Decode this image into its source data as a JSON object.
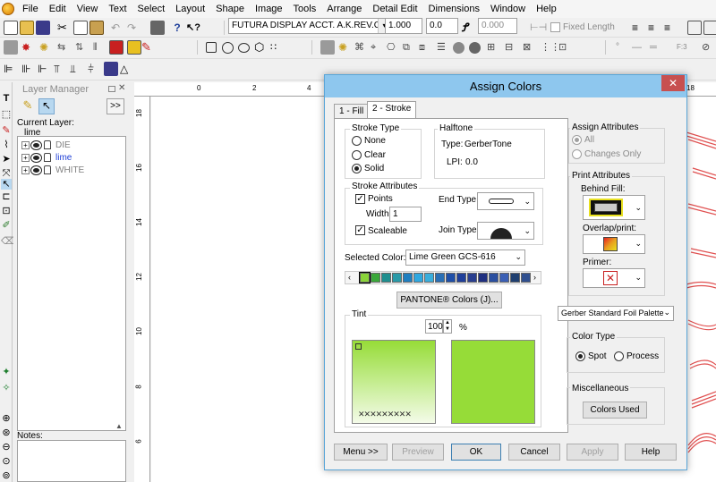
{
  "menu": [
    "File",
    "Edit",
    "View",
    "Text",
    "Select",
    "Layout",
    "Shape",
    "Image",
    "Tools",
    "Arrange",
    "Detail Edit",
    "Dimensions",
    "Window",
    "Help"
  ],
  "toolbar": {
    "font_name": "FUTURA DISPLAY ACCT. A.K.REV.C",
    "height_value": "1.000",
    "spacing_value": "0.0",
    "slant_value": "0.000",
    "fixed_length_label": "Fixed Length",
    "zoom_label": "F:3"
  },
  "layer_manager": {
    "title": "Layer Manager",
    "expand_label": ">>",
    "current_layer_label": "Current Layer:",
    "current_layer": "lime",
    "layers": [
      {
        "name": "DIE",
        "color": "#808080"
      },
      {
        "name": "lime",
        "color": "#1f3fd6"
      },
      {
        "name": "WHITE",
        "color": "#808080"
      }
    ],
    "notes_label": "Notes:"
  },
  "rulers": {
    "h": [
      "0",
      "2",
      "4",
      "18"
    ],
    "v": [
      "18",
      "16",
      "14",
      "12",
      "10",
      "8",
      "6"
    ]
  },
  "dialog": {
    "title": "Assign Colors",
    "close": "✕",
    "tabs": [
      "1 - Fill",
      "2 - Stroke"
    ],
    "active_tab": "2 - Stroke",
    "stroke_type": {
      "label": "Stroke Type",
      "options": [
        "None",
        "Clear",
        "Solid"
      ],
      "selected": "Solid"
    },
    "halftone": {
      "label": "Halftone",
      "type_label": "Type:",
      "type_value": "GerberTone",
      "lpi_label": "LPI:",
      "lpi_value": "0.0"
    },
    "stroke_attributes": {
      "label": "Stroke Attributes",
      "points_label": "Points",
      "width_label": "Width:",
      "width_value": "1",
      "scaleable_label": "Scaleable",
      "end_type_label": "End Type:",
      "join_type_label": "Join Type:"
    },
    "selected_color": {
      "label": "Selected Color:",
      "value": "Lime Green GCS-616"
    },
    "palette_swatches": [
      "#8ad43a",
      "#3aa83a",
      "#1f8f8f",
      "#2a9aa8",
      "#1f7fc0",
      "#2fa8e0",
      "#3aaedc",
      "#2a6fb5",
      "#1f4fa8",
      "#1f3f9a",
      "#2a3f8f",
      "#1f2f80",
      "#2a4fa0",
      "#3a5fb5",
      "#1f3f70",
      "#2f4f8f"
    ],
    "pantone_label": "PANTONE® Colors (J)...",
    "tint": {
      "label": "Tint",
      "value": "100",
      "unit": "%",
      "color": "#96dc38"
    },
    "assign_attributes": {
      "label": "Assign Attributes",
      "options": [
        "All",
        "Changes Only"
      ],
      "selected": "All"
    },
    "print_attributes": {
      "label": "Print Attributes",
      "behind_fill_label": "Behind Fill:",
      "overlap_label": "Overlap/print:",
      "primer_label": "Primer:"
    },
    "palette_select": "Gerber Standard Foil Palette",
    "color_type": {
      "label": "Color Type",
      "options": [
        "Spot",
        "Process"
      ],
      "selected": "Spot"
    },
    "misc": {
      "label": "Miscellaneous",
      "colors_used": "Colors Used"
    },
    "buttons": [
      "Menu >>",
      "Preview",
      "OK",
      "Cancel",
      "Apply",
      "Help"
    ]
  }
}
